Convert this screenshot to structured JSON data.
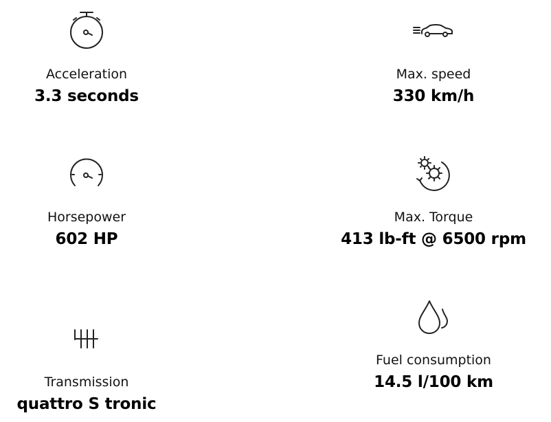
{
  "specs": {
    "acceleration": {
      "label": "Acceleration",
      "value": "3.3 seconds",
      "icon": "stopwatch-icon"
    },
    "max_speed": {
      "label": "Max. speed",
      "value": "330 km/h",
      "icon": "car-speed-icon"
    },
    "horsepower": {
      "label": "Horsepower",
      "value": "602 HP",
      "icon": "speedometer-icon"
    },
    "max_torque": {
      "label": "Max. Torque",
      "value": "413 lb-ft @ 6500 rpm",
      "icon": "gears-icon"
    },
    "transmission": {
      "label": "Transmission",
      "value": "quattro S tronic",
      "icon": "gear-shift-icon"
    },
    "fuel_consumption": {
      "label": "Fuel consumption",
      "value": "14.5 l/100 km",
      "icon": "fuel-drops-icon"
    }
  }
}
